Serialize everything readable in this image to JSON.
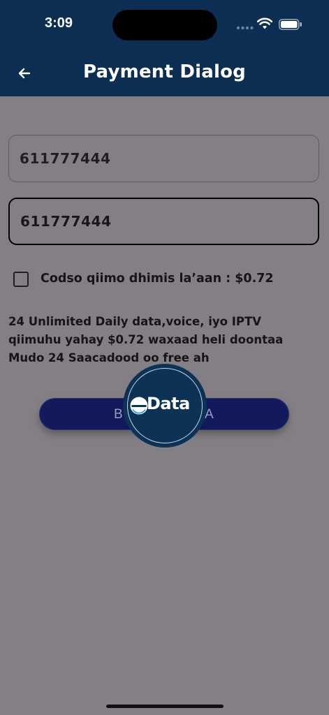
{
  "status_bar": {
    "time": "3:09",
    "icons": [
      "signal-icon",
      "wifi-icon",
      "battery-icon"
    ]
  },
  "header": {
    "title": "Payment Dialog",
    "back_icon": "arrow-left-icon"
  },
  "form": {
    "phone_field_1": {
      "value": "611777444"
    },
    "phone_field_2": {
      "value": "611777444"
    },
    "discount_checkbox": {
      "checked": false,
      "label": "Codso qiimo dhimis la’aan : $0.72"
    },
    "description_lines": [
      "24 Unlimited Daily data,voice, iyo IPTV",
      "qiimuhu yahay $0.72 waxaad heli doontaa",
      "Mudo 24 Saacadood oo free ah"
    ],
    "buy_button": {
      "label_left": "B",
      "label_right": "A"
    }
  },
  "loader": {
    "logo_text": "Data",
    "logo_icon": "edata-logo-icon"
  },
  "colors": {
    "appbar": "#0b2e52",
    "overlay_background": "#847f84",
    "button": "#121a5c",
    "loader_circle": "#0c3256",
    "logo_accent": "#2a9fd8"
  }
}
